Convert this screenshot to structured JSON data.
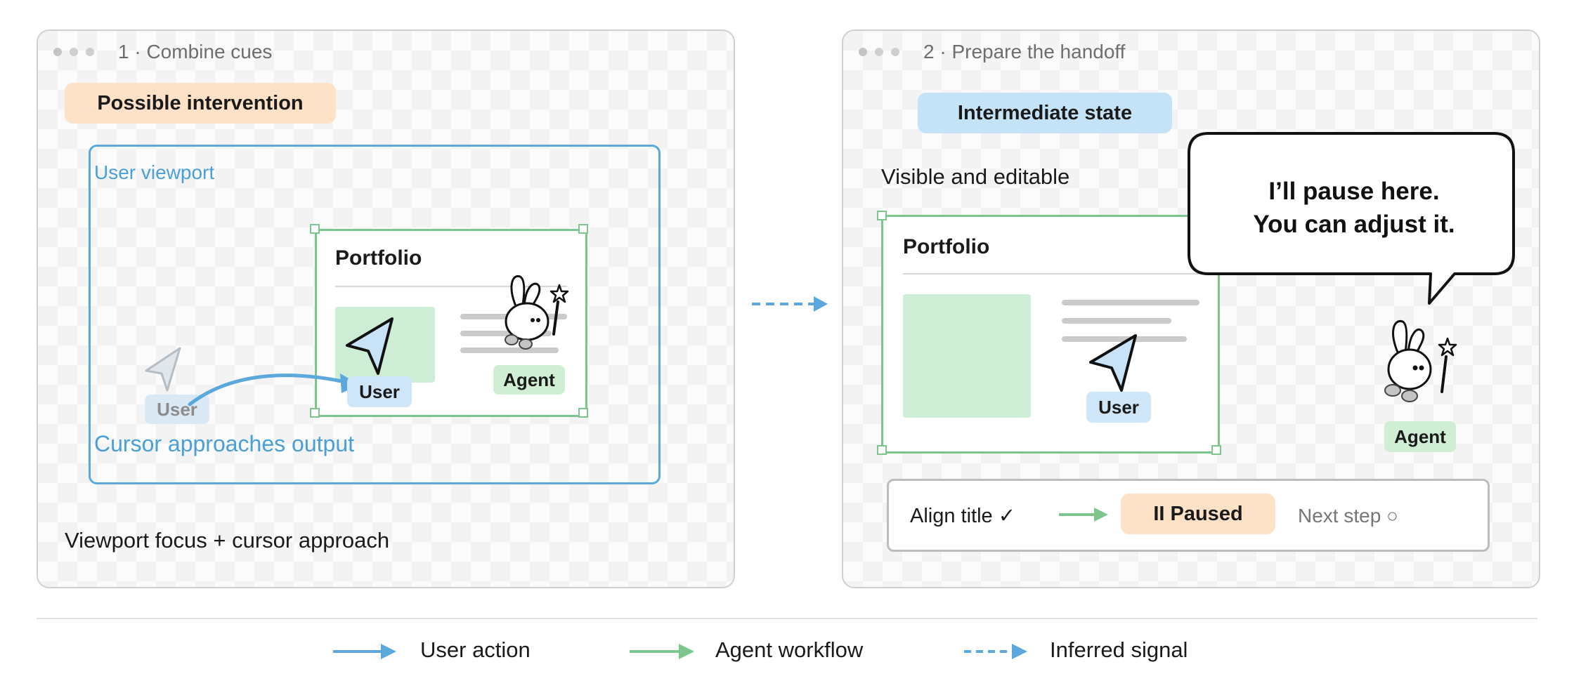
{
  "panel1": {
    "title": "1 · Combine cues",
    "badge": "Possible intervention",
    "viewport_label": "User viewport",
    "output_title": "Portfolio",
    "user_label_faded": "User",
    "user_label": "User",
    "agent_label": "Agent",
    "approach_label": "Cursor approaches output",
    "caption": "Viewport focus + cursor approach"
  },
  "panel2": {
    "title": "2 · Prepare the handoff",
    "badge": "Intermediate state",
    "subtitle": "Visible and editable",
    "output_title": "Portfolio",
    "user_label": "User",
    "agent_label": "Agent",
    "speech_line1": "I’ll pause here.",
    "speech_line2": "You can adjust it.",
    "timeline": {
      "step1": "Align title ✓",
      "step2": "II Paused",
      "step3": "Next step ○"
    }
  },
  "legend": {
    "user_action": "User action",
    "agent_workflow": "Agent workflow",
    "inferred_signal": "Inferred signal"
  },
  "colors": {
    "user_blue": "#5aa8dc",
    "agent_green": "#7cc68d",
    "pause_orange": "#fde2c8",
    "intermediate_blue": "#c5e3f8"
  }
}
